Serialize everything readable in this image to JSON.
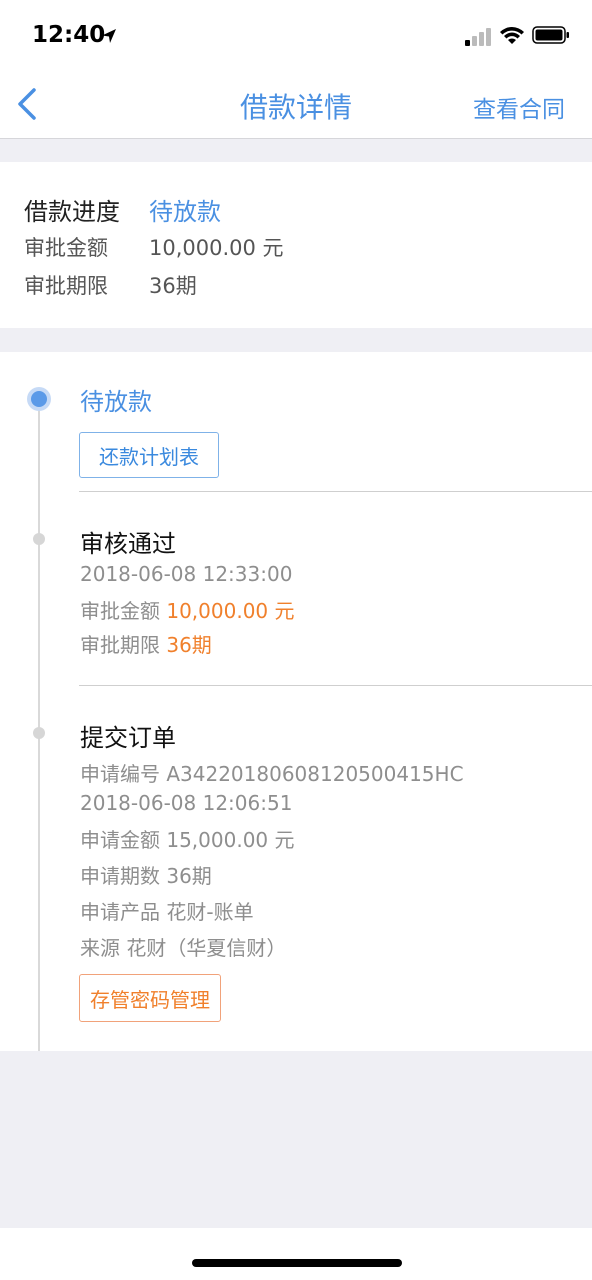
{
  "status_bar": {
    "time": "12:40"
  },
  "nav": {
    "title": "借款详情",
    "right_action": "查看合同"
  },
  "summary": {
    "progress_label": "借款进度",
    "progress_value": "待放款",
    "amount_label": "审批金额",
    "amount_value": "10,000.00 元",
    "term_label": "审批期限",
    "term_value": "36期"
  },
  "timeline": {
    "step1": {
      "title": "待放款",
      "button": "还款计划表"
    },
    "step2": {
      "title": "审核通过",
      "time": "2018-06-08 12:33:00",
      "amount_label": "审批金额",
      "amount_value": "10,000.00 元",
      "term_label": "审批期限",
      "term_value": "36期"
    },
    "step3": {
      "title": "提交订单",
      "order_no": "申请编号 A34220180608120500415HC",
      "time": "2018-06-08 12:06:51",
      "amount": "申请金额 15,000.00 元",
      "periods": "申请期数 36期",
      "product": "申请产品 花财-账单",
      "source": "来源 花财（华夏信财）",
      "button": "存管密码管理"
    }
  },
  "colors": {
    "accent": "#4a90e2",
    "highlight": "#f0802c"
  }
}
